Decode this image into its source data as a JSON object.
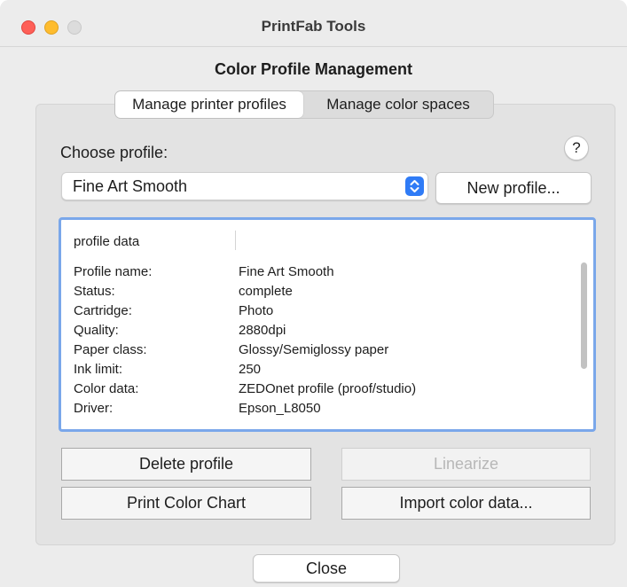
{
  "window": {
    "title": "PrintFab Tools"
  },
  "dialog": {
    "title": "Color Profile Management"
  },
  "tabs": [
    {
      "label": "Manage printer profiles",
      "active": true
    },
    {
      "label": "Manage color spaces",
      "active": false
    }
  ],
  "profile": {
    "choose_label": "Choose profile:",
    "help_label": "?",
    "selected": "Fine Art Smooth",
    "new_button": "New profile..."
  },
  "profile_data": {
    "header": "profile data",
    "rows": [
      {
        "key": "Profile name:",
        "value": "Fine Art Smooth"
      },
      {
        "key": "Status:",
        "value": "complete"
      },
      {
        "key": "Cartridge:",
        "value": "Photo"
      },
      {
        "key": "Quality:",
        "value": "2880dpi"
      },
      {
        "key": "Paper class:",
        "value": "Glossy/Semiglossy paper"
      },
      {
        "key": "Ink limit:",
        "value": "250"
      },
      {
        "key": "Color data:",
        "value": "ZEDOnet profile (proof/studio)"
      },
      {
        "key": "Driver:",
        "value": "Epson_L8050"
      }
    ]
  },
  "actions": {
    "delete": "Delete profile",
    "linearize": "Linearize",
    "print_chart": "Print Color Chart",
    "import": "Import color data..."
  },
  "footer": {
    "close": "Close"
  },
  "colors": {
    "accent": "#2f7bf6",
    "focus_ring": "#7aa7ea"
  }
}
